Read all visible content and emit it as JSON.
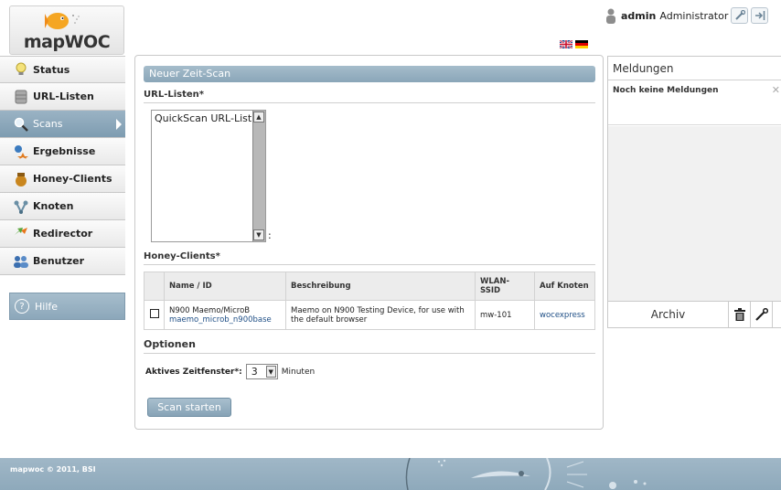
{
  "app": {
    "logo_text": "mapWOC"
  },
  "nav": {
    "items": [
      {
        "label": "Status",
        "icon": "lightbulb-icon"
      },
      {
        "label": "URL-Listen",
        "icon": "database-icon"
      },
      {
        "label": "Scans",
        "icon": "magnifier-icon",
        "active": true
      },
      {
        "label": "Ergebnisse",
        "icon": "results-icon"
      },
      {
        "label": "Honey-Clients",
        "icon": "honeypot-icon"
      },
      {
        "label": "Knoten",
        "icon": "nodes-icon"
      },
      {
        "label": "Redirector",
        "icon": "redirect-arrows-icon"
      },
      {
        "label": "Benutzer",
        "icon": "users-icon"
      }
    ],
    "help_label": "Hilfe"
  },
  "main": {
    "title": "Neuer Zeit-Scan",
    "url_lists_label": "URL-Listen*",
    "url_lists_options": [
      "QuickScan URL-List"
    ],
    "colon": ":",
    "honey_clients_label": "Honey-Clients*",
    "table": {
      "headers": [
        "",
        "Name / ID",
        "Beschreibung",
        "WLAN-SSID",
        "Auf Knoten"
      ],
      "rows": [
        {
          "name": "N900 Maemo/MicroB",
          "id": "maemo_microb_n900base",
          "description": "Maemo on N900 Testing Device, for use with the default browser",
          "ssid": "mw-101",
          "node": "wocexpress"
        }
      ]
    },
    "options_label": "Optionen",
    "time_window_label": "Aktives Zeitfenster*:",
    "time_window_value": "3",
    "time_window_unit": "Minuten",
    "scan_button": "Scan starten"
  },
  "userbar": {
    "username": "admin",
    "role": "Administrator"
  },
  "messages": {
    "title": "Meldungen",
    "empty_text": "Noch keine Meldungen",
    "archive_label": "Archiv"
  },
  "footer": {
    "copyright": "mapwoc © 2011, BSI"
  },
  "colors": {
    "accent": "#8aa6b9",
    "link": "#1f4f86"
  }
}
